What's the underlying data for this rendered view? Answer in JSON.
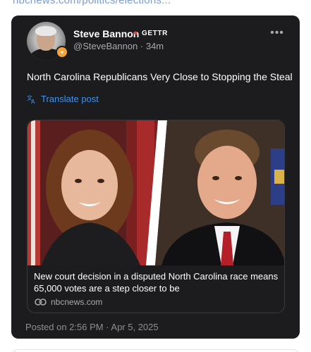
{
  "top_link": "nbcnews.com/politics/elections...",
  "author": {
    "name": "Steve Bannon",
    "platform_badge": "GETTR",
    "handle": "@SteveBannon",
    "time_ago": "34m",
    "badge_icon": "verified-badge-icon"
  },
  "post": {
    "text": "North Carolina Republicans Very Close to Stopping the Steal",
    "translate_label": "Translate post"
  },
  "link_card": {
    "title": "New court decision in a disputed North Carolina race means 65,000 votes are a step closer to be",
    "source": "nbcnews.com"
  },
  "posted_on": "Posted on 2:56 PM · Apr 5, 2025",
  "colors": {
    "card_bg": "#1c1c1e",
    "link_blue": "#3d93f5",
    "flame_red": "#e0443e"
  }
}
